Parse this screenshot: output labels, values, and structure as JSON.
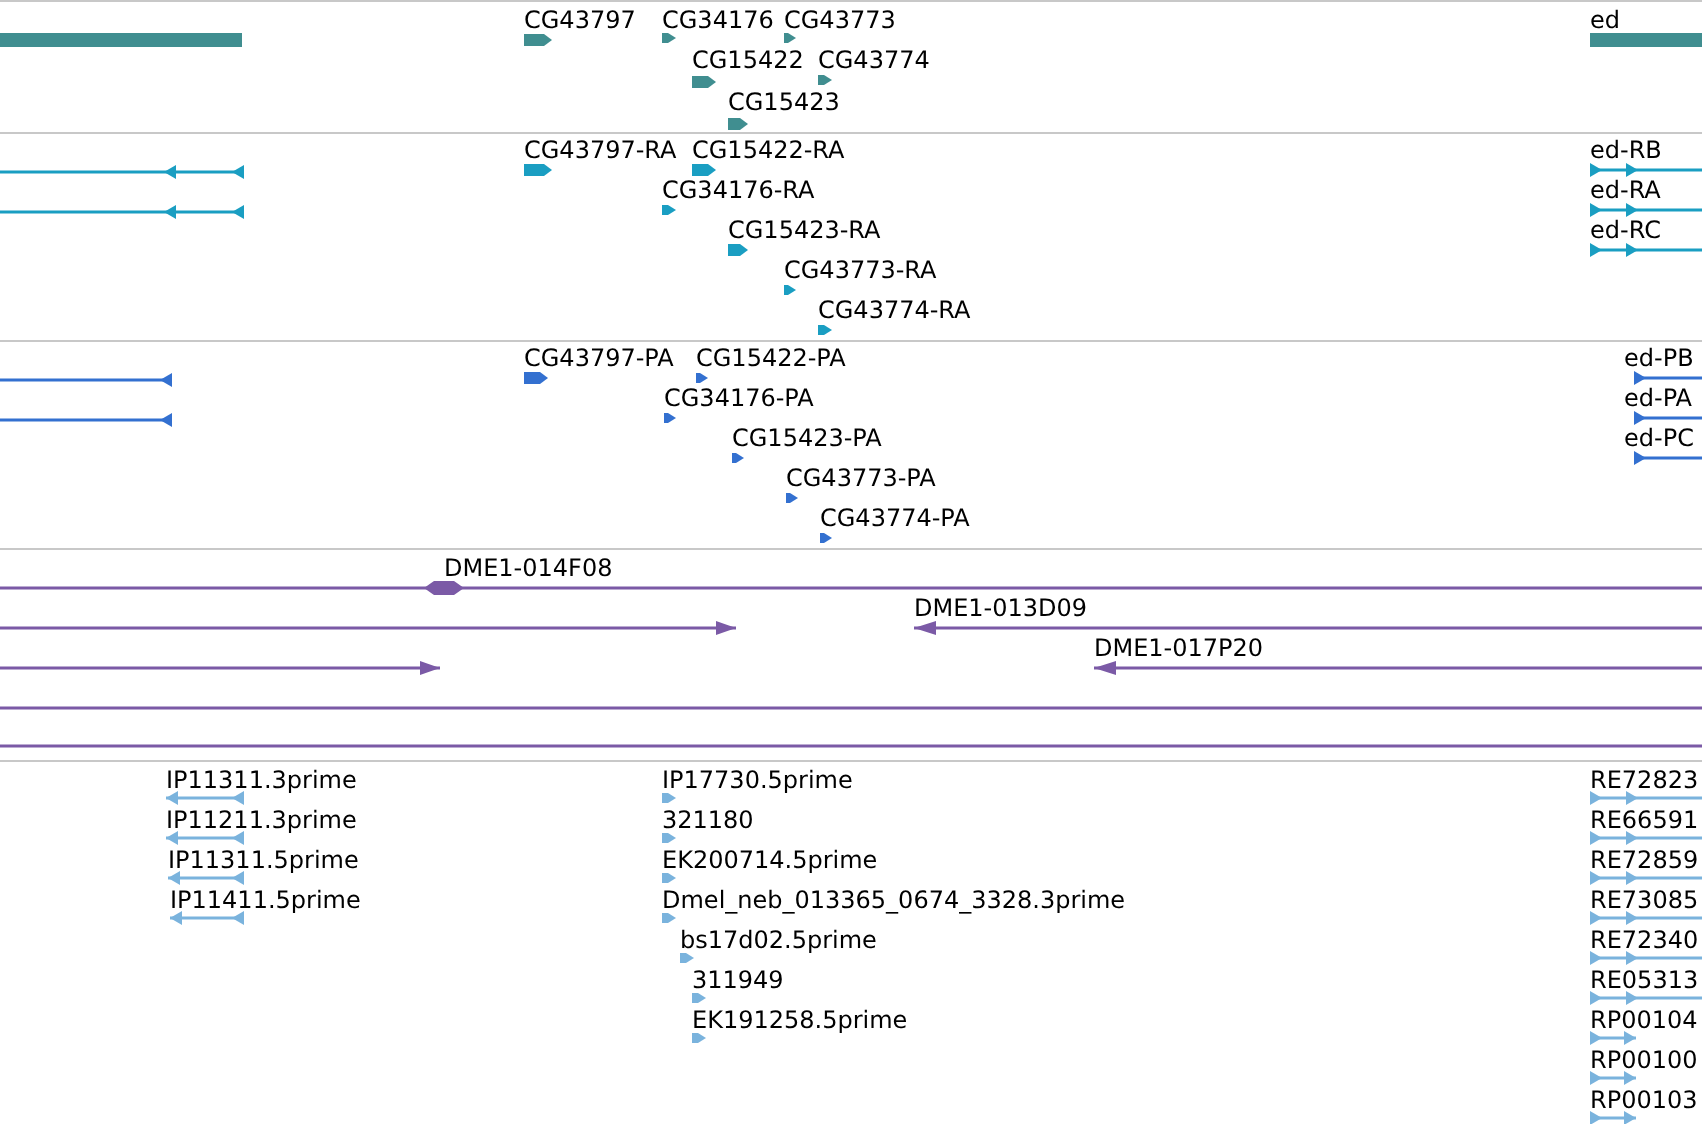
{
  "tracks": [
    {
      "color": "#408e90",
      "features": [
        {
          "kind": "bar"
        },
        {
          "kind": "arrow",
          "label": "CG43797",
          "reverse": false
        },
        {
          "kind": "arrow",
          "label": "CG34176",
          "reverse": false
        },
        {
          "kind": "arrow",
          "label": "CG43773",
          "reverse": false
        },
        {
          "kind": "arrow",
          "label": "CG15422",
          "reverse": false
        },
        {
          "kind": "arrow",
          "label": "CG43774",
          "reverse": false
        },
        {
          "kind": "arrow",
          "label": "CG15423",
          "reverse": false
        },
        {
          "kind": "bar",
          "label": "ed"
        }
      ]
    },
    {
      "color": "#1a9ec2",
      "features": [
        {
          "kind": "spliced",
          "reverse": true
        },
        {
          "kind": "spliced",
          "reverse": true
        },
        {
          "kind": "arrow",
          "label": "CG43797-RA",
          "reverse": false
        },
        {
          "kind": "arrow",
          "label": "CG15422-RA",
          "reverse": false
        },
        {
          "kind": "arrow",
          "label": "CG34176-RA",
          "reverse": false
        },
        {
          "kind": "arrow",
          "label": "CG15423-RA",
          "reverse": false
        },
        {
          "kind": "arrow",
          "label": "CG43773-RA",
          "reverse": false
        },
        {
          "kind": "arrow",
          "label": "CG43774-RA",
          "reverse": false
        },
        {
          "kind": "spliced",
          "label": "ed-RB",
          "reverse": false
        },
        {
          "kind": "spliced",
          "label": "ed-RA",
          "reverse": false
        },
        {
          "kind": "spliced",
          "label": "ed-RC",
          "reverse": false
        }
      ]
    },
    {
      "color": "#3370d0",
      "features": [
        {
          "kind": "spliced",
          "reverse": true
        },
        {
          "kind": "spliced",
          "reverse": true
        },
        {
          "kind": "arrow",
          "label": "CG43797-PA",
          "reverse": false
        },
        {
          "kind": "arrow",
          "label": "CG15422-PA",
          "reverse": false
        },
        {
          "kind": "arrow",
          "label": "CG34176-PA",
          "reverse": false
        },
        {
          "kind": "arrow",
          "label": "CG15423-PA",
          "reverse": false
        },
        {
          "kind": "arrow",
          "label": "CG43773-PA",
          "reverse": false
        },
        {
          "kind": "arrow",
          "label": "CG43774-PA",
          "reverse": false
        },
        {
          "kind": "spliced",
          "label": "ed-PB",
          "reverse": false
        },
        {
          "kind": "spliced",
          "label": "ed-PA",
          "reverse": false
        },
        {
          "kind": "spliced",
          "label": "ed-PC",
          "reverse": false
        }
      ]
    },
    {
      "color": "#7b5aa6",
      "features": [
        {
          "kind": "double",
          "label": "DME1-014F08"
        },
        {
          "kind": "spliced",
          "reverse": false
        },
        {
          "kind": "spliced",
          "label": "DME1-013D09",
          "reverse": true
        },
        {
          "kind": "spliced",
          "reverse": false
        },
        {
          "kind": "spliced",
          "label": "DME1-017P20",
          "reverse": true
        },
        {
          "kind": "line"
        },
        {
          "kind": "line"
        }
      ]
    },
    {
      "color": "#7ab3dd",
      "features": [
        {
          "kind": "spliced",
          "label": "IP11311.3prime",
          "reverse": true
        },
        {
          "kind": "spliced",
          "label": "IP11211.3prime",
          "reverse": true
        },
        {
          "kind": "spliced",
          "label": "IP11311.5prime",
          "reverse": true
        },
        {
          "kind": "spliced",
          "label": "IP11411.5prime",
          "reverse": true
        },
        {
          "kind": "arrow",
          "label": "IP17730.5prime",
          "reverse": false
        },
        {
          "kind": "arrow",
          "label": "321180",
          "reverse": false
        },
        {
          "kind": "arrow",
          "label": "EK200714.5prime",
          "reverse": false
        },
        {
          "kind": "arrow",
          "label": "Dmel_neb_013365_0674_3328.3prime",
          "reverse": false
        },
        {
          "kind": "arrow",
          "label": "bs17d02.5prime",
          "reverse": false
        },
        {
          "kind": "arrow",
          "label": "311949",
          "reverse": false
        },
        {
          "kind": "arrow",
          "label": "EK191258.5prime",
          "reverse": false
        },
        {
          "kind": "spliced",
          "label": "RE72823",
          "reverse": false
        },
        {
          "kind": "spliced",
          "label": "RE66591",
          "reverse": false
        },
        {
          "kind": "spliced",
          "label": "RE72859",
          "reverse": false
        },
        {
          "kind": "spliced",
          "label": "RE73085",
          "reverse": false
        },
        {
          "kind": "spliced",
          "label": "RE72340",
          "reverse": false
        },
        {
          "kind": "spliced",
          "label": "RE05313",
          "reverse": false
        },
        {
          "kind": "spliced",
          "label": "RP00104",
          "reverse": false
        },
        {
          "kind": "spliced",
          "label": "RP00100",
          "reverse": false
        },
        {
          "kind": "spliced",
          "label": "RP00103",
          "reverse": false
        }
      ]
    }
  ]
}
